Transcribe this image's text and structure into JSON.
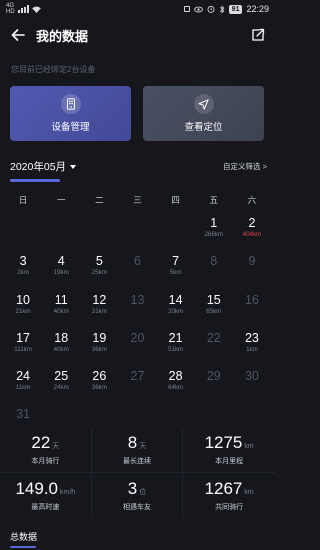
{
  "status_bar": {
    "net_lines": [
      "4G",
      "HD"
    ],
    "speed": "",
    "battery": "91",
    "time": "22:29"
  },
  "header": {
    "title": "我的数据",
    "back_icon": "arrow-left-icon",
    "share_icon": "share-icon"
  },
  "hint": "您目前已经绑定2台设备",
  "cards": [
    {
      "label": "设备管理",
      "icon": "device-phone-icon"
    },
    {
      "label": "查看定位",
      "icon": "navigation-arrow-icon"
    }
  ],
  "month": {
    "label": "2020年05月",
    "custom_filter": "自定义筛选 >"
  },
  "weekdays": [
    "日",
    "一",
    "二",
    "三",
    "四",
    "五",
    "六"
  ],
  "calendar": {
    "leading_blanks": 5,
    "days": [
      {
        "num": "1",
        "km": "266km",
        "dim": false,
        "red": false
      },
      {
        "num": "2",
        "km": "404km",
        "dim": false,
        "red": true
      },
      {
        "num": "3",
        "km": "2km",
        "dim": false,
        "red": false
      },
      {
        "num": "4",
        "km": "19km",
        "dim": false,
        "red": false
      },
      {
        "num": "5",
        "km": "25km",
        "dim": false,
        "red": false
      },
      {
        "num": "6",
        "km": "",
        "dim": true,
        "red": false
      },
      {
        "num": "7",
        "km": "5km",
        "dim": false,
        "red": false
      },
      {
        "num": "8",
        "km": "",
        "dim": true,
        "red": false
      },
      {
        "num": "9",
        "km": "",
        "dim": true,
        "red": false
      },
      {
        "num": "10",
        "km": "21km",
        "dim": false,
        "red": false
      },
      {
        "num": "11",
        "km": "40km",
        "dim": false,
        "red": false
      },
      {
        "num": "12",
        "km": "31km",
        "dim": false,
        "red": false
      },
      {
        "num": "13",
        "km": "",
        "dim": true,
        "red": false
      },
      {
        "num": "14",
        "km": "20km",
        "dim": false,
        "red": false
      },
      {
        "num": "15",
        "km": "65km",
        "dim": false,
        "red": false
      },
      {
        "num": "16",
        "km": "",
        "dim": true,
        "red": false
      },
      {
        "num": "17",
        "km": "111km",
        "dim": false,
        "red": false
      },
      {
        "num": "18",
        "km": "40km",
        "dim": false,
        "red": false
      },
      {
        "num": "19",
        "km": "36km",
        "dim": false,
        "red": false
      },
      {
        "num": "20",
        "km": "",
        "dim": true,
        "red": false
      },
      {
        "num": "21",
        "km": "51km",
        "dim": false,
        "red": false
      },
      {
        "num": "22",
        "km": "",
        "dim": true,
        "red": false
      },
      {
        "num": "23",
        "km": "1km",
        "dim": false,
        "red": false
      },
      {
        "num": "24",
        "km": "11km",
        "dim": false,
        "red": false
      },
      {
        "num": "25",
        "km": "24km",
        "dim": false,
        "red": false
      },
      {
        "num": "26",
        "km": "36km",
        "dim": false,
        "red": false
      },
      {
        "num": "27",
        "km": "",
        "dim": true,
        "red": false
      },
      {
        "num": "28",
        "km": "64km",
        "dim": false,
        "red": false
      },
      {
        "num": "29",
        "km": "",
        "dim": true,
        "red": false
      },
      {
        "num": "30",
        "km": "",
        "dim": true,
        "red": false
      },
      {
        "num": "31",
        "km": "",
        "dim": true,
        "red": false
      }
    ]
  },
  "stats": [
    {
      "value": "22",
      "unit": "天",
      "label": "本月骑行"
    },
    {
      "value": "8",
      "unit": "天",
      "label": "最长连续"
    },
    {
      "value": "1275",
      "unit": "km",
      "label": "本月里程"
    },
    {
      "value": "149.0",
      "unit": "km/h",
      "label": "最高时速"
    },
    {
      "value": "3",
      "unit": "位",
      "label": "相遇车友"
    },
    {
      "value": "1267",
      "unit": "km",
      "label": "共同骑行"
    }
  ],
  "footer": {
    "title": "总数据"
  },
  "colors": {
    "background": "#15171c",
    "accent": "#5e67d8",
    "device_card": "#4c53a8",
    "location_card": "#444a5c",
    "highlight_red": "#e0463c"
  }
}
